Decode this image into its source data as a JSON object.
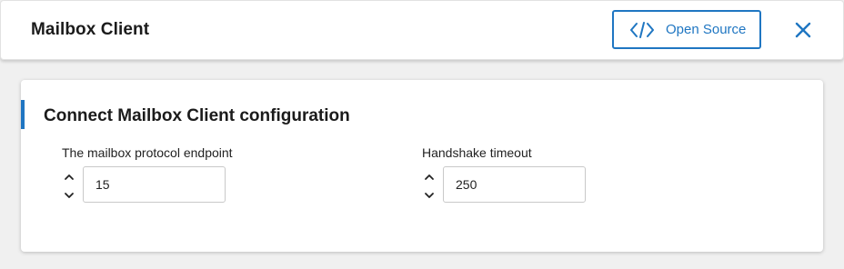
{
  "header": {
    "title": "Mailbox Client",
    "open_source_label": "Open Source",
    "code_icon": "code-icon",
    "close_icon": "close-icon"
  },
  "card": {
    "title": "Connect Mailbox Client configuration",
    "accent_color": "#1f76c2",
    "fields": [
      {
        "label": "The mailbox protocol endpoint",
        "value": "15",
        "increment_icon": "chevron-up-icon",
        "decrement_icon": "chevron-down-icon"
      },
      {
        "label": "Handshake timeout",
        "value": "250",
        "increment_icon": "chevron-up-icon",
        "decrement_icon": "chevron-down-icon"
      }
    ]
  },
  "colors": {
    "accent": "#1f76c2",
    "background": "#f0f0f0",
    "surface": "#ffffff"
  }
}
